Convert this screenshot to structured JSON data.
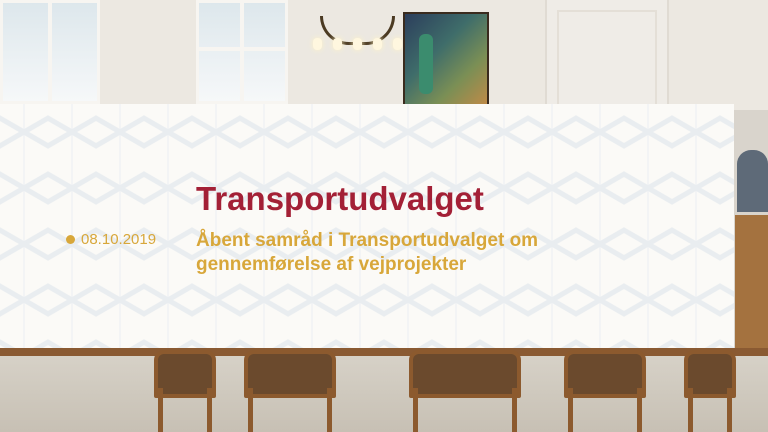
{
  "overlay": {
    "title": "Transportudvalget",
    "date": "08.10.2019",
    "subtitle_line1": "Åbent samråd i Transportudvalget om",
    "subtitle_line2": "gennemførelse af vejprojekter"
  },
  "colors": {
    "title": "#a32036",
    "accent": "#d8a73a",
    "card_background": "#fbfaf7"
  }
}
